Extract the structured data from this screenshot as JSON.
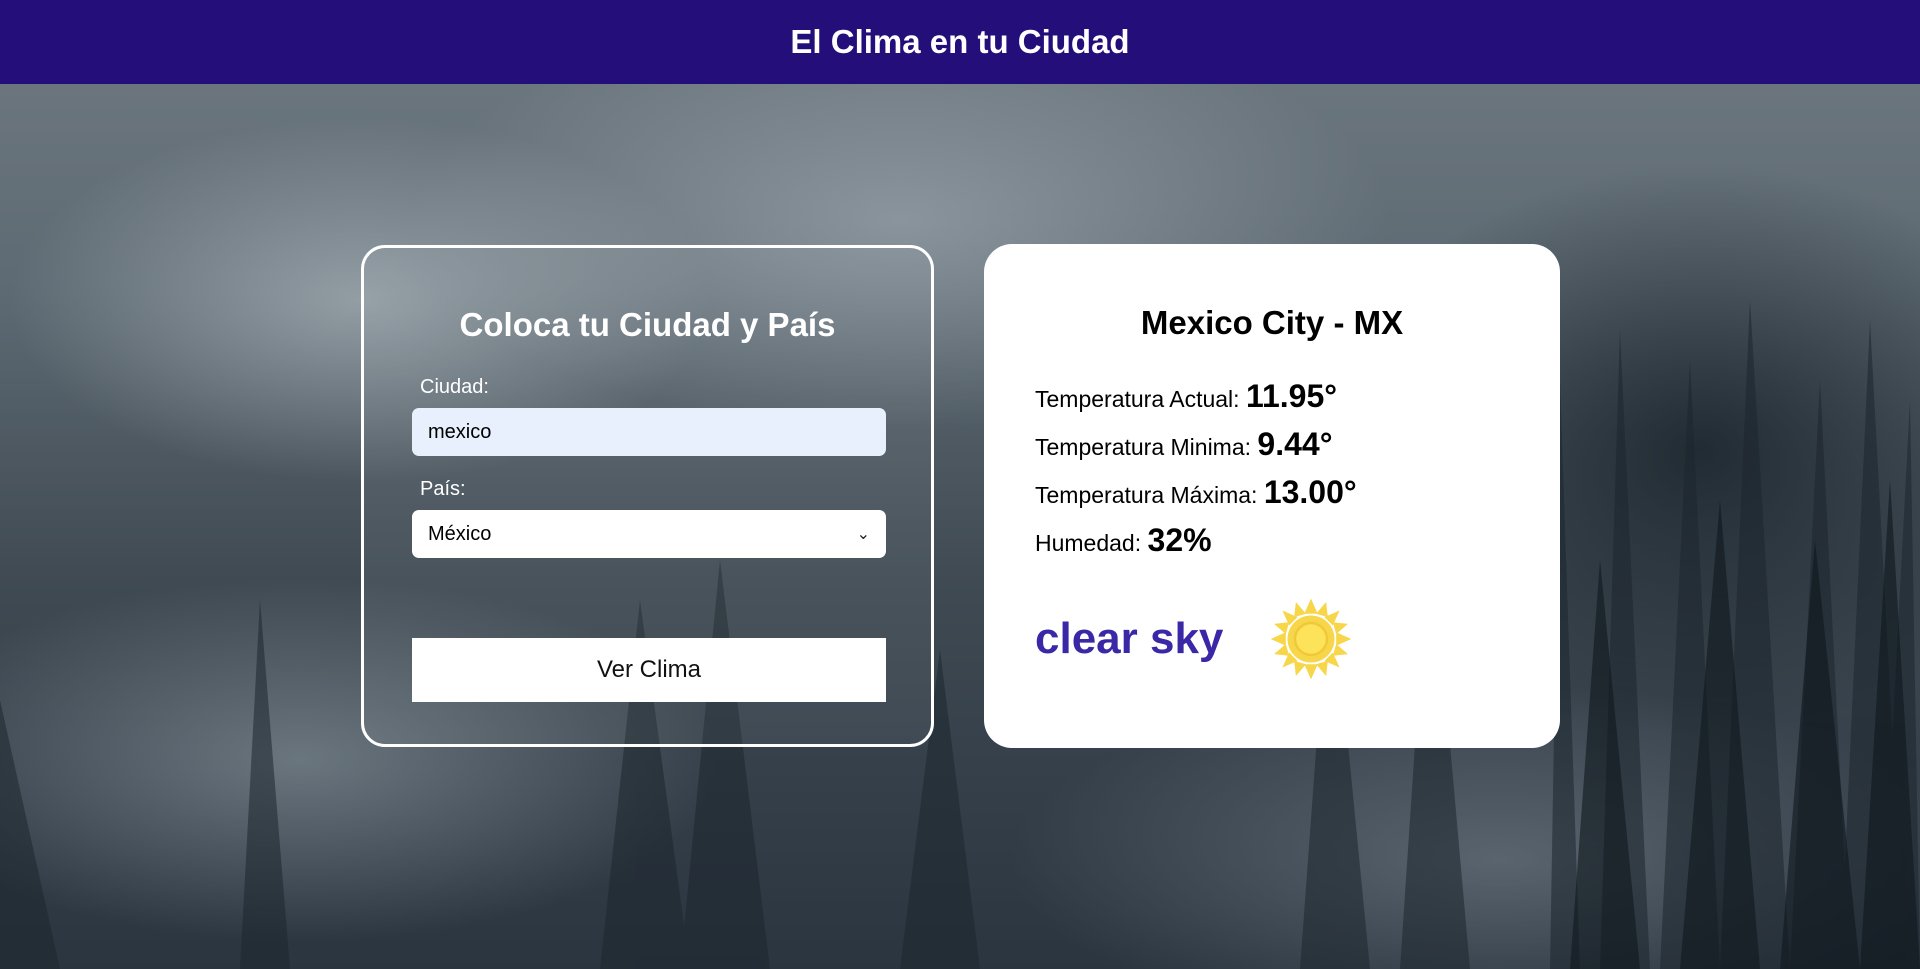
{
  "header": {
    "title": "El Clima en tu Ciudad"
  },
  "form": {
    "title": "Coloca tu Ciudad y País",
    "city_label": "Ciudad:",
    "city_value": "mexico",
    "country_label": "País:",
    "country_selected": "México",
    "submit_label": "Ver Clima"
  },
  "result": {
    "location": "Mexico City - MX",
    "current_label": "Temperatura Actual:",
    "current_value": "11.95°",
    "min_label": "Temperatura Minima:",
    "min_value": "9.44°",
    "max_label": "Temperatura Máxima:",
    "max_value": "13.00°",
    "humidity_label": "Humedad:",
    "humidity_value": "32%",
    "description": "clear sky",
    "icon": "sun-icon"
  },
  "colors": {
    "header_bg": "#240e7a",
    "description": "#3a28a6",
    "sun": "#f7d64a",
    "input_bg": "#e8f0fe"
  }
}
